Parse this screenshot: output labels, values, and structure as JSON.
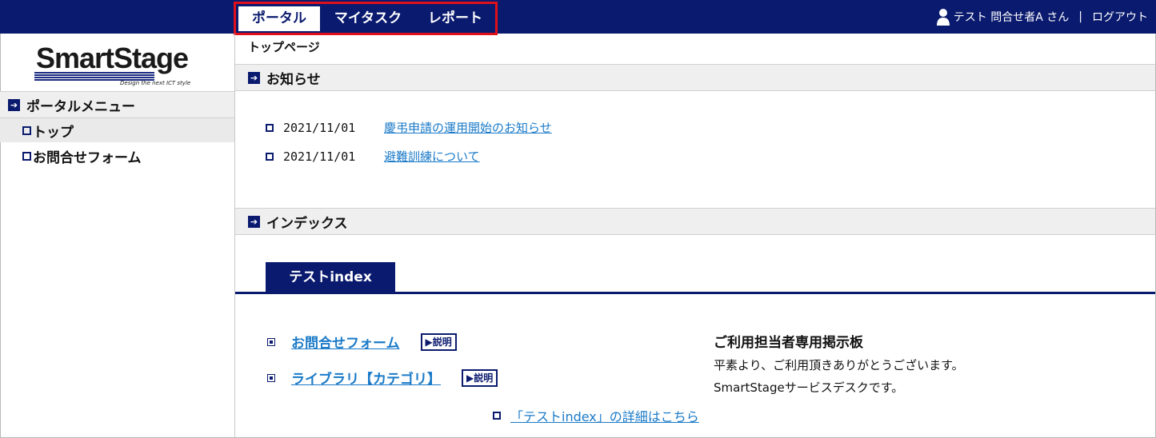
{
  "nav": {
    "tabs": [
      {
        "label": "ポータル",
        "active": true
      },
      {
        "label": "マイタスク",
        "active": false
      },
      {
        "label": "レポート",
        "active": false
      }
    ],
    "outline_color": "#e0101a",
    "bg_color": "#0a1a6e"
  },
  "user": {
    "name": "テスト 問合せ者A さん",
    "separator": "|",
    "logout": "ログアウト",
    "icon": "user-icon"
  },
  "logo": {
    "text": "SmartStage",
    "tagline": "Design the next ICT style"
  },
  "sidebar": {
    "header": "ポータルメニュー",
    "items": [
      {
        "label": "トップ",
        "active": true
      },
      {
        "label": "お問合せフォーム",
        "active": false
      }
    ]
  },
  "main": {
    "breadcrumb": "トップページ",
    "news_header": "お知らせ",
    "news": [
      {
        "date": "2021/11/01",
        "title": "慶弔申請の運用開始のお知らせ"
      },
      {
        "date": "2021/11/01",
        "title": "避難訓練について"
      }
    ],
    "index_header": "インデックス",
    "index_tab": "テストindex",
    "index_items": [
      {
        "label": "お問合せフォーム",
        "button": "▶説明"
      },
      {
        "label": "ライブラリ【カテゴリ】",
        "button": "▶説明"
      }
    ],
    "detail_link": "「テストindex」の詳細はこちら",
    "board": {
      "title": "ご利用担当者専用掲示板",
      "line1": "平素より、ご利用頂きありがとうございます。",
      "line2": "SmartStageサービスデスクです。"
    }
  }
}
